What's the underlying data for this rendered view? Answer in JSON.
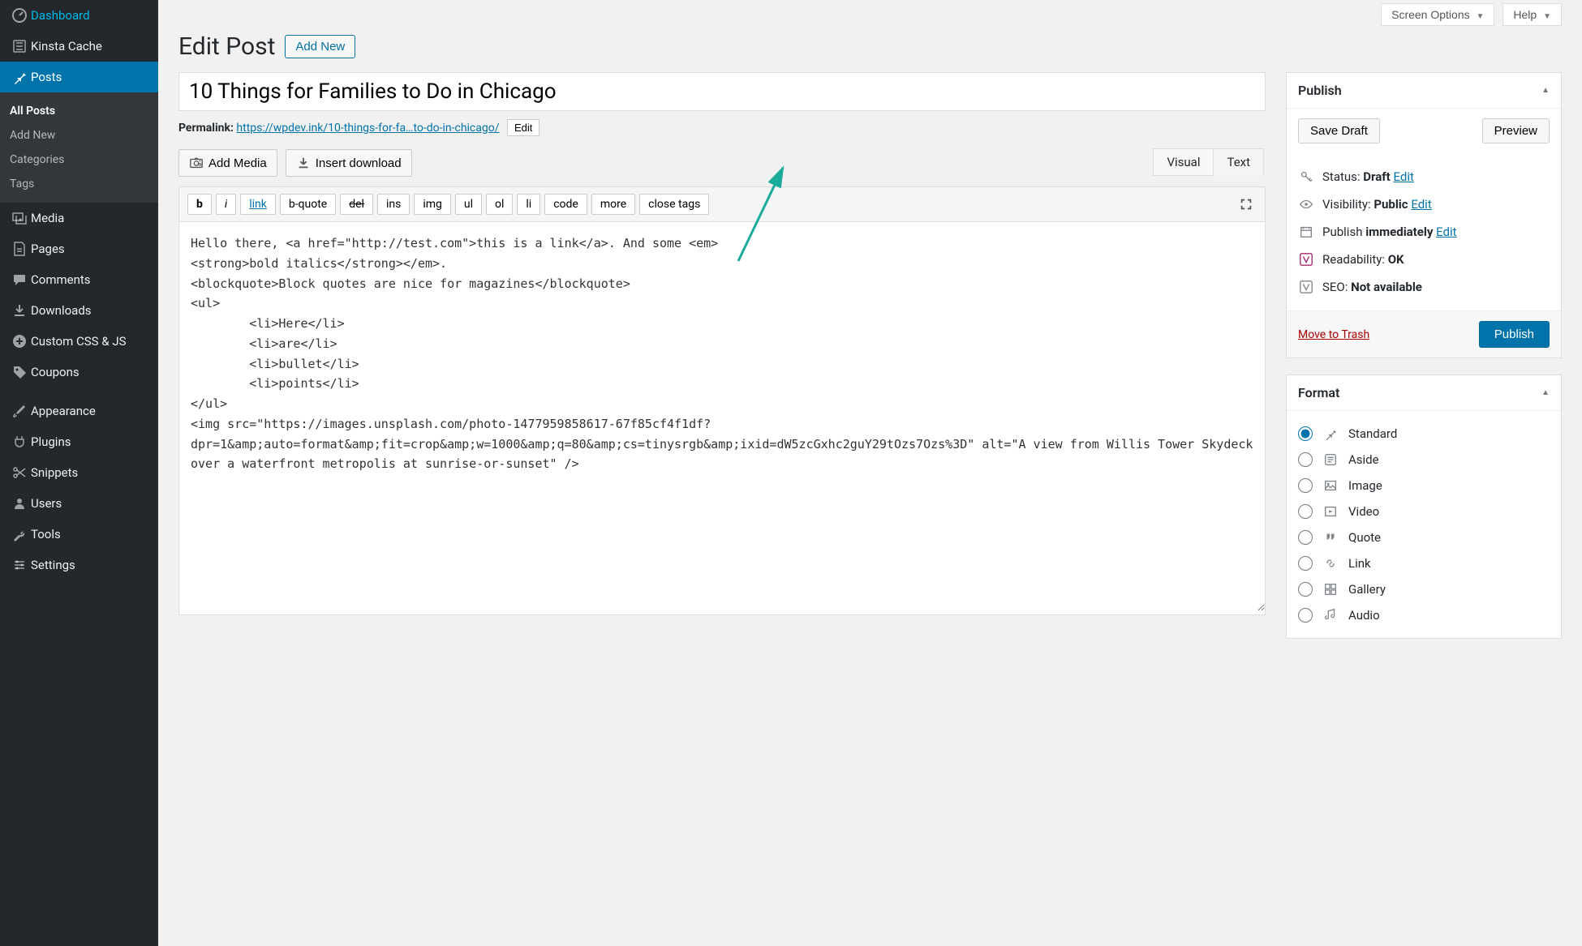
{
  "topbar": {
    "screen_options": "Screen Options",
    "help": "Help"
  },
  "sidebar": {
    "items": [
      {
        "label": "Dashboard",
        "icon": "dashboard"
      },
      {
        "label": "Kinsta Cache",
        "icon": "kinsta"
      },
      {
        "label": "Posts",
        "icon": "pin",
        "current": true,
        "sub": [
          {
            "label": "All Posts",
            "current": true
          },
          {
            "label": "Add New"
          },
          {
            "label": "Categories"
          },
          {
            "label": "Tags"
          }
        ]
      },
      {
        "label": "Media",
        "icon": "media"
      },
      {
        "label": "Pages",
        "icon": "page"
      },
      {
        "label": "Comments",
        "icon": "comment"
      },
      {
        "label": "Downloads",
        "icon": "download"
      },
      {
        "label": "Custom CSS & JS",
        "icon": "plus"
      },
      {
        "label": "Coupons",
        "icon": "tag"
      },
      {
        "label": "Appearance",
        "icon": "brush"
      },
      {
        "label": "Plugins",
        "icon": "plug"
      },
      {
        "label": "Snippets",
        "icon": "scissors"
      },
      {
        "label": "Users",
        "icon": "user"
      },
      {
        "label": "Tools",
        "icon": "wrench"
      },
      {
        "label": "Settings",
        "icon": "settings"
      }
    ]
  },
  "header": {
    "title": "Edit Post",
    "add_new": "Add New"
  },
  "post": {
    "title": "10 Things for Families to Do in Chicago",
    "permalink_label": "Permalink:",
    "permalink_base": "https://wpdev.ink/",
    "permalink_slug": "10-things-for-fa…to-do-in-chicago/",
    "permalink_edit": "Edit"
  },
  "editor": {
    "add_media": "Add Media",
    "insert_download": "Insert download",
    "tabs": {
      "visual": "Visual",
      "text": "Text"
    },
    "qtags": [
      "b",
      "i",
      "link",
      "b-quote",
      "del",
      "ins",
      "img",
      "ul",
      "ol",
      "li",
      "code",
      "more",
      "close tags"
    ],
    "content": "Hello there, <a href=\"http://test.com\">this is a link</a>. And some <em>\n<strong>bold italics</strong></em>.\n<blockquote>Block quotes are nice for magazines</blockquote>\n<ul>\n \t<li>Here</li>\n \t<li>are</li>\n \t<li>bullet</li>\n \t<li>points</li>\n</ul>\n<img src=\"https://images.unsplash.com/photo-1477959858617-67f85cf4f1df?dpr=1&amp;auto=format&amp;fit=crop&amp;w=1000&amp;q=80&amp;cs=tinysrgb&amp;ixid=dW5zcGxhc2guY29tOzs7Ozs%3D\" alt=\"A view from Willis Tower Skydeck over a waterfront metropolis at sunrise-or-sunset\" />"
  },
  "publish": {
    "title": "Publish",
    "save_draft": "Save Draft",
    "preview": "Preview",
    "status_label": "Status:",
    "status_value": "Draft",
    "visibility_label": "Visibility:",
    "visibility_value": "Public",
    "publish_label": "Publish",
    "publish_value": "immediately",
    "readability_label": "Readability:",
    "readability_value": "OK",
    "seo_label": "SEO:",
    "seo_value": "Not available",
    "edit": "Edit",
    "trash": "Move to Trash",
    "publish_btn": "Publish"
  },
  "format": {
    "title": "Format",
    "options": [
      {
        "label": "Standard",
        "checked": true
      },
      {
        "label": "Aside"
      },
      {
        "label": "Image"
      },
      {
        "label": "Video"
      },
      {
        "label": "Quote"
      },
      {
        "label": "Link"
      },
      {
        "label": "Gallery"
      },
      {
        "label": "Audio"
      }
    ]
  }
}
